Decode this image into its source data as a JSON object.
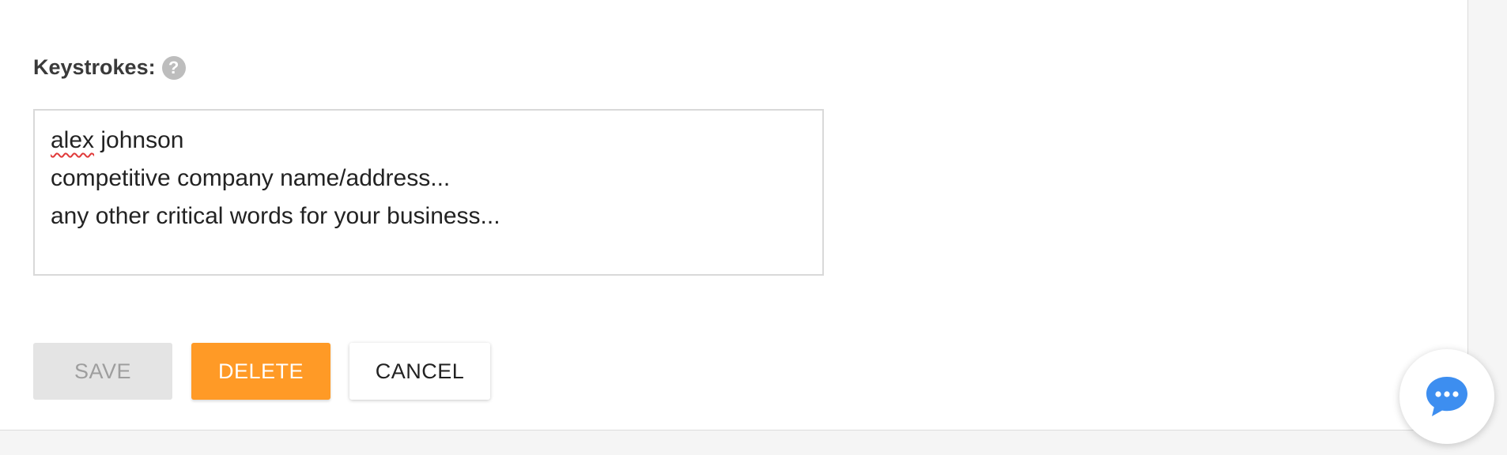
{
  "form": {
    "keystrokes_label": "Keystrokes:",
    "help_icon_glyph": "?",
    "keystrokes_lines": [
      "alex",
      " johnson",
      "competitive company name/address...",
      "any other critical words for your business..."
    ]
  },
  "buttons": {
    "save_label": "SAVE",
    "delete_label": "DELETE",
    "cancel_label": "CANCEL",
    "save_disabled": true
  },
  "colors": {
    "accent_orange": "#ff9a26",
    "chat_blue": "#3d8ef0",
    "disabled_bg": "#e4e4e4"
  },
  "icons": {
    "help": "question-circle-icon",
    "chat": "chat-bubble-icon"
  }
}
